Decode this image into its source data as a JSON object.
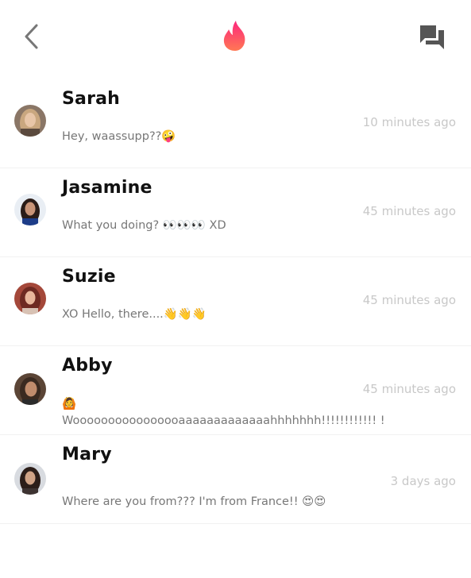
{
  "header": {
    "back_icon": "chevron-left-icon",
    "logo_icon": "flame-logo-icon",
    "chat_icon": "chat-bubbles-icon",
    "accent": "#fd5068"
  },
  "conversations": [
    {
      "name": "Sarah",
      "time": "10 minutes ago",
      "message": "Hey, waassupp??🤪"
    },
    {
      "name": "Jasamine",
      "time": "45 minutes ago",
      "message": "What you doing? 👀👀👀 XD"
    },
    {
      "name": "Suzie",
      "time": "45 minutes ago",
      "message": "XO Hello, there....👋👋👋"
    },
    {
      "name": "Abby",
      "time": "45 minutes ago",
      "message_emoji": "🙆",
      "message": "Woooooooooooooooaaaaaaaaaaaaahhhhhhh!!!!!!!!!!!! !"
    },
    {
      "name": "Mary",
      "time": "3 days ago",
      "message": "Where are you from??? I'm from France!! 😍😍"
    }
  ]
}
